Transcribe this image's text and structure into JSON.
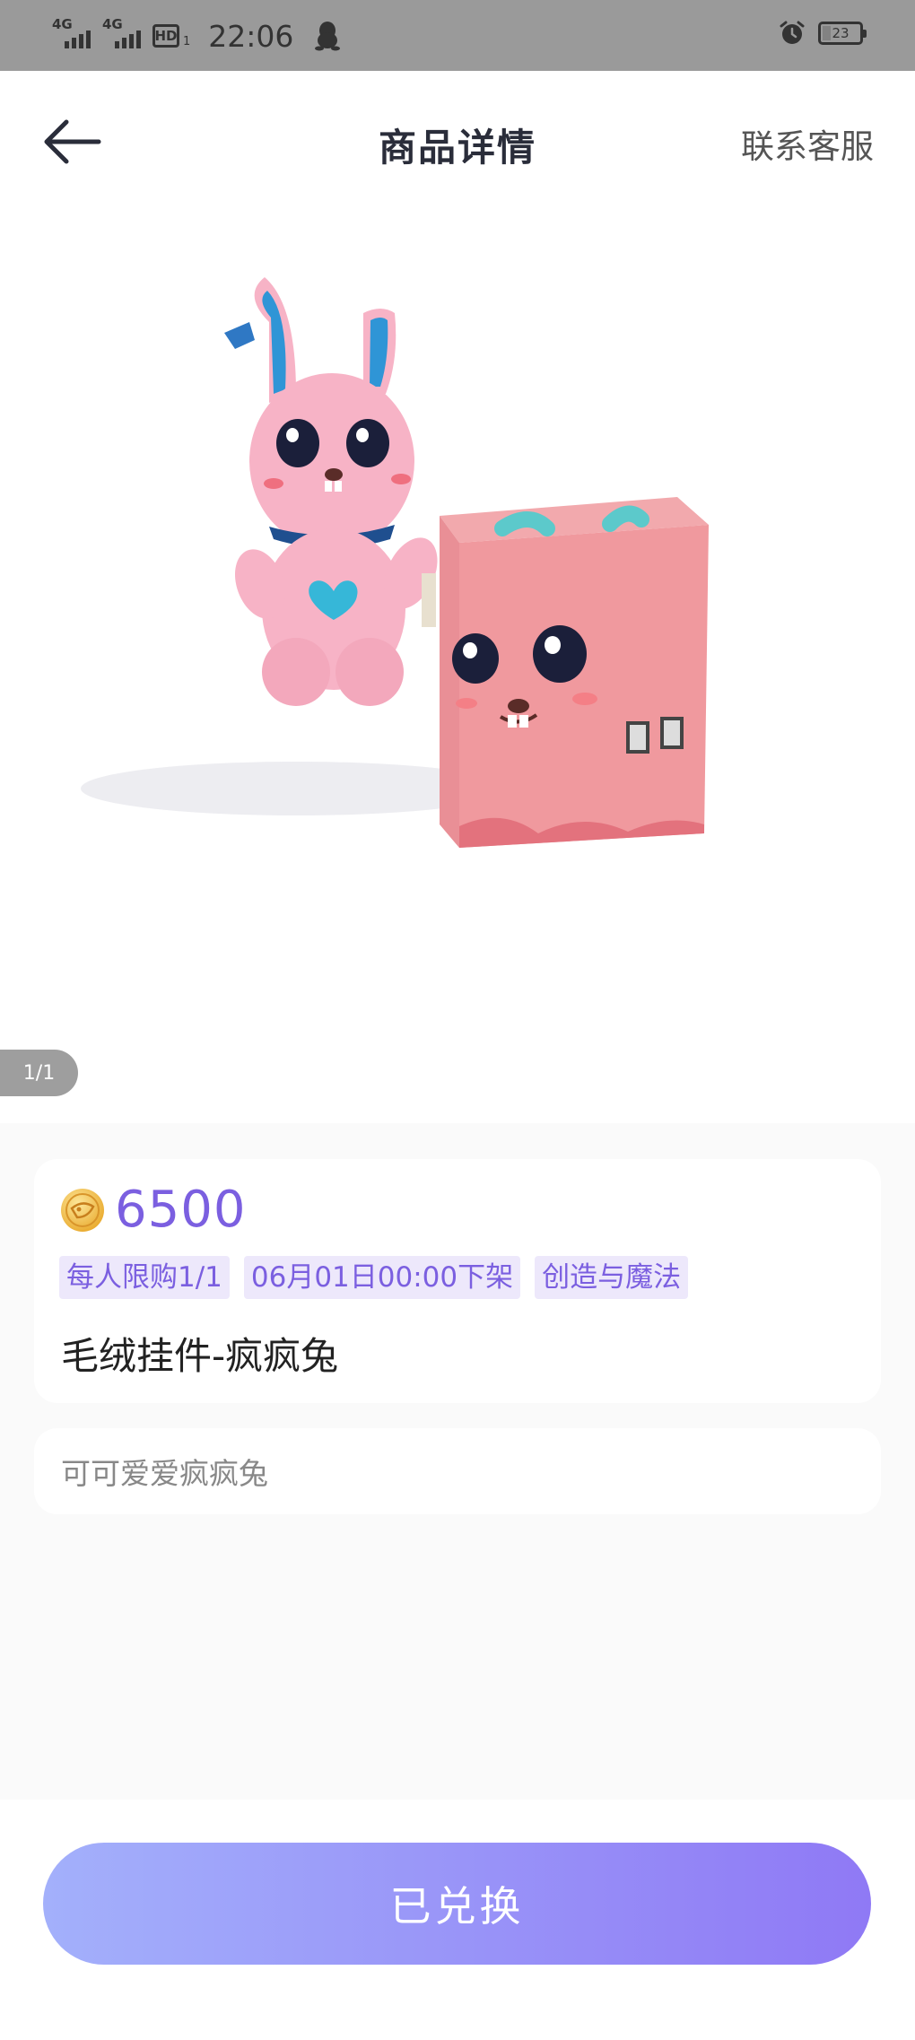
{
  "status_bar": {
    "signal1": "4G",
    "signal2": "4G",
    "hd": "HD",
    "hd_sub": "1",
    "time": "22:06",
    "battery": "23",
    "battery_level": 0.23
  },
  "header": {
    "title": "商品详情",
    "contact": "联系客服"
  },
  "gallery": {
    "indicator": "1/1"
  },
  "product": {
    "price": "6500",
    "tags": [
      "每人限购1/1",
      "06月01日00:00下架",
      "创造与魔法"
    ],
    "name": "毛绒挂件-疯疯兔",
    "description": "可可爱爱疯疯兔"
  },
  "action": {
    "button_label": "已兑换"
  },
  "colors": {
    "accent": "#7b5fe0",
    "tag_bg": "#ede8fb",
    "button_start": "#a3b0fb",
    "button_end": "#8f79f5"
  }
}
